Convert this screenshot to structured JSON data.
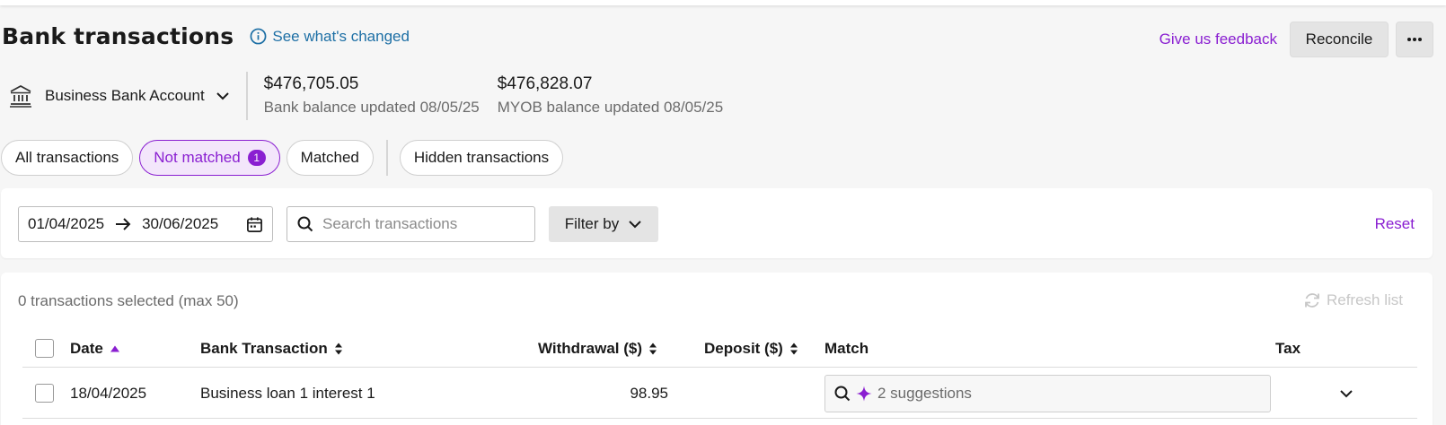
{
  "header": {
    "title": "Bank transactions",
    "whats_changed": "See what's changed",
    "feedback": "Give us feedback",
    "reconcile": "Reconcile",
    "more": "···"
  },
  "account": {
    "name": "Business Bank Account",
    "bank_balance": "$476,705.05",
    "bank_balance_label": "Bank balance updated 08/05/25",
    "myob_balance": "$476,828.07",
    "myob_balance_label": "MYOB balance updated 08/05/25"
  },
  "tabs": [
    {
      "label": "All transactions"
    },
    {
      "label": "Not matched",
      "count": "1",
      "active": true
    },
    {
      "label": "Matched"
    },
    {
      "label": "Hidden transactions"
    }
  ],
  "filters": {
    "date_from": "01/04/2025",
    "date_to": "30/06/2025",
    "search_placeholder": "Search transactions",
    "filter_by": "Filter by",
    "reset": "Reset"
  },
  "table": {
    "selected_text": "0 transactions selected (max 50)",
    "refresh": "Refresh list",
    "columns": {
      "date": "Date",
      "bank_transaction": "Bank Transaction",
      "withdrawal": "Withdrawal ($)",
      "deposit": "Deposit ($)",
      "match": "Match",
      "tax": "Tax"
    },
    "rows": [
      {
        "date": "18/04/2025",
        "description": "Business loan 1 interest 1",
        "withdrawal": "98.95",
        "deposit": "",
        "match": "2 suggestions"
      }
    ]
  },
  "colors": {
    "accent": "#8a1fd1",
    "link_blue": "#1d6fa5"
  }
}
